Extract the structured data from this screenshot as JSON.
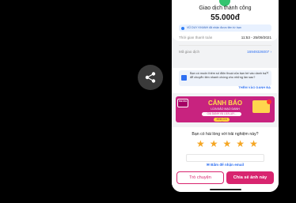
{
  "transaction": {
    "status": "Giao dịch thành công",
    "amount": "55.000đ",
    "notice": "VŨ DUY KHANH đã nhận được tiền từ bạn",
    "time_label": "Thời gian thanh toán",
    "time_value": "11:53 - 25/09/2021",
    "id_label": "Mã giao dịch",
    "id_value": "16949326007"
  },
  "tip": {
    "text": "Bạn có muốn thêm số điện thoại của bạn bè vào danh bạ để chuyển tiền nhanh chóng cho những lần sau?",
    "action": "THÊM VÀO DANH BẠ"
  },
  "ad": {
    "logo": "mo mo",
    "title": "CẢNH BÁO",
    "subtitle": "LỪA ĐẢO MẠO DANH",
    "pill": "GIẢ DANH VÀ LỪA LẤY...",
    "button": "XEM CHI TIẾT"
  },
  "rating": {
    "question": "Bạn có hài lòng với trải nghiệm này?",
    "stars": 5,
    "email_link": "Bấm để nhận email"
  },
  "actions": {
    "chat": "Trò chuyện",
    "share": "Chia sẻ ảnh này"
  },
  "colors": {
    "brand": "#d8256f",
    "link": "#2d6ff2",
    "star": "#f5a623",
    "success": "#33c46f"
  }
}
